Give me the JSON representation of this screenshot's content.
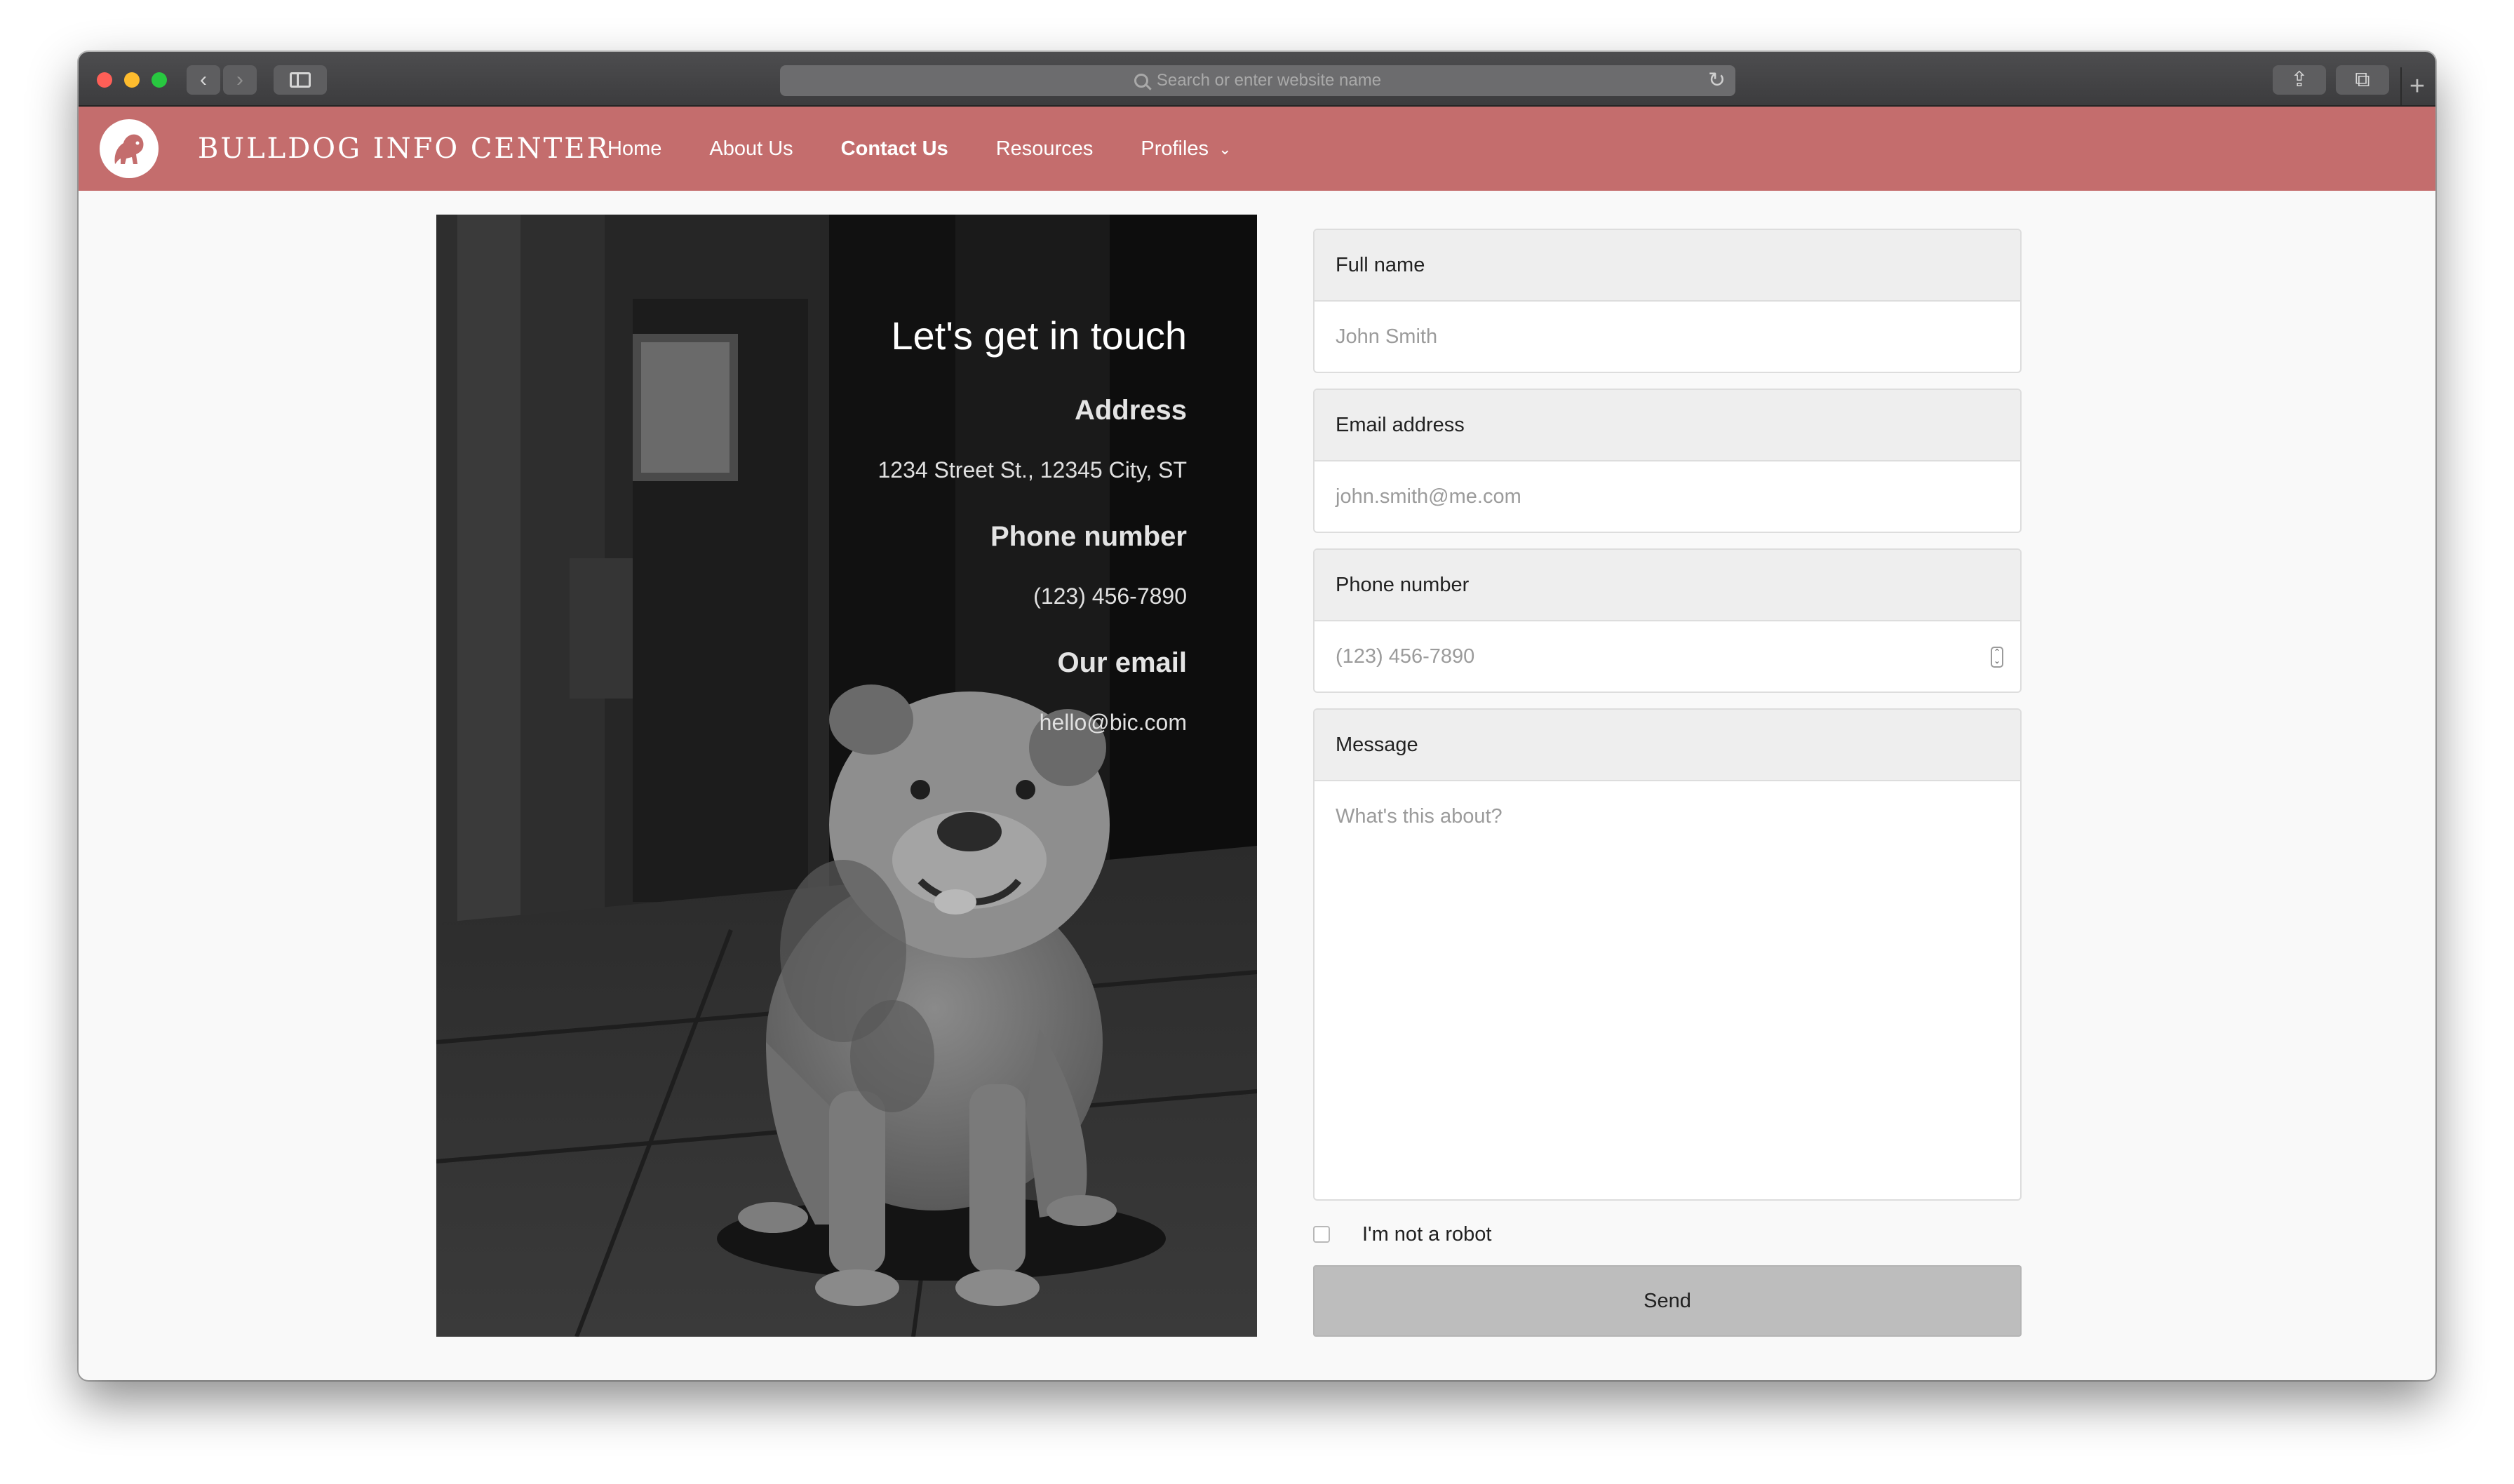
{
  "browser": {
    "url_placeholder": "Search or enter website name",
    "back_glyph": "‹",
    "forward_glyph": "›",
    "reload_glyph": "↻",
    "share_glyph": "⇪",
    "tabs_glyph": "⧉",
    "newtab_glyph": "+"
  },
  "site": {
    "brand": "BULLDOG INFO CENTER",
    "accent_color": "#c46d6d",
    "nav": {
      "home": "Home",
      "about": "About Us",
      "contact": "Contact Us",
      "resources": "Resources",
      "profiles": "Profiles",
      "caret": "⌄"
    }
  },
  "contact": {
    "title": "Let's get in touch",
    "address_label": "Address",
    "address_value": "1234 Street St., 12345 City, ST",
    "phone_label": "Phone number",
    "phone_value": "(123) 456-7890",
    "email_label": "Our email",
    "email_value": "hello@bic.com"
  },
  "form": {
    "fullname_label": "Full name",
    "fullname_placeholder": "John Smith",
    "email_label": "Email address",
    "email_placeholder": "john.smith@me.com",
    "phone_label": "Phone number",
    "phone_placeholder": "(123) 456-7890",
    "message_label": "Message",
    "message_placeholder": "What's this about?",
    "robot_label": "I'm not a robot",
    "send_label": "Send"
  }
}
